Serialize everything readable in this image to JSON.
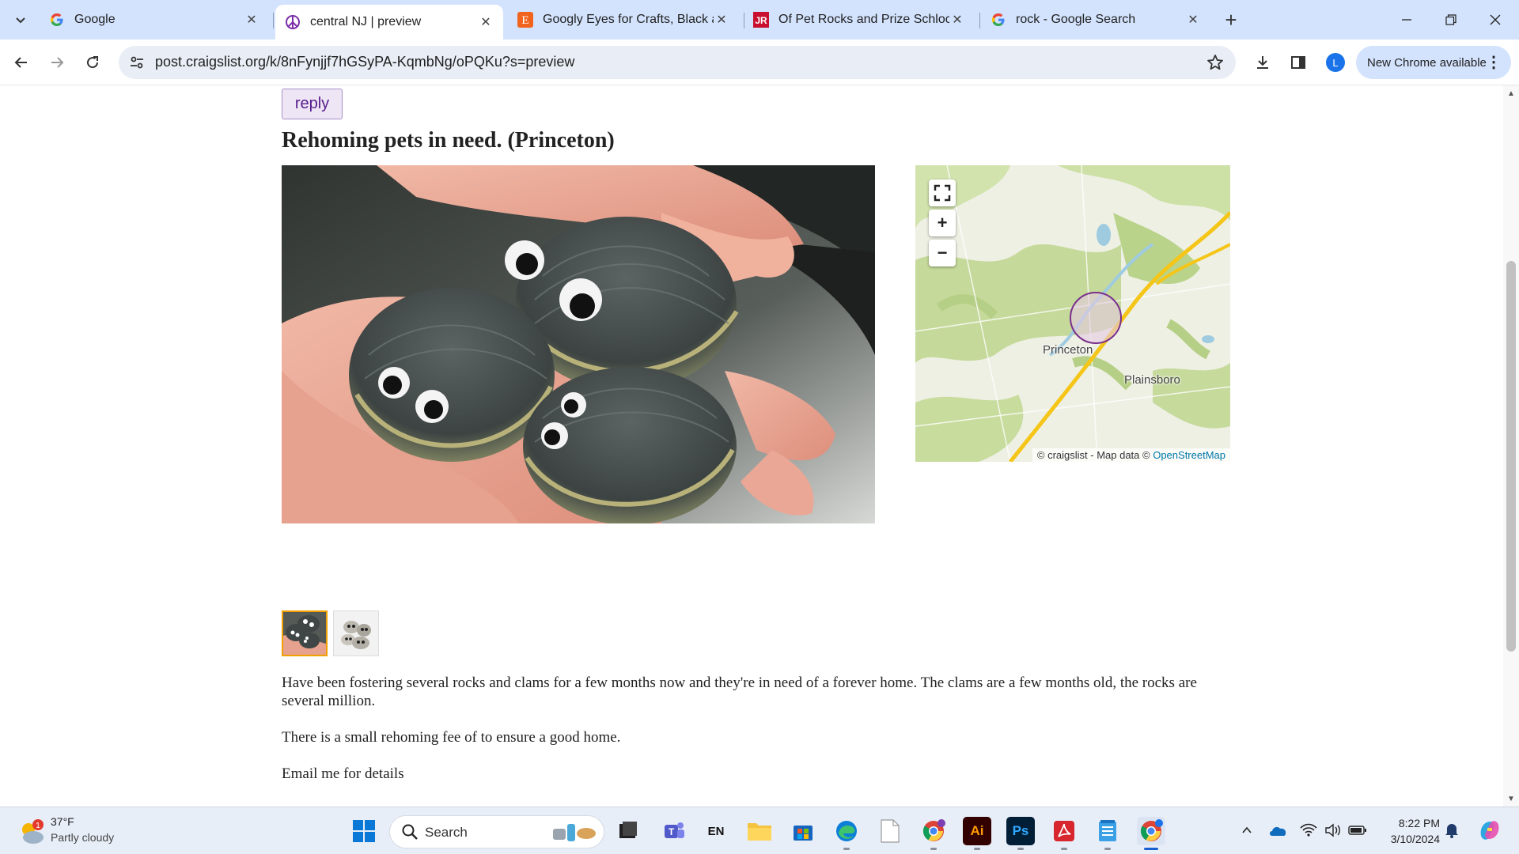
{
  "browser": {
    "tabs": [
      {
        "title": "Google",
        "favicon": "google-g-icon"
      },
      {
        "title": "central NJ | preview",
        "favicon": "peace-sign-icon",
        "active": true
      },
      {
        "title": "Googly Eyes for Crafts, Black an",
        "favicon": "etsy-e-icon"
      },
      {
        "title": "Of Pet Rocks and Prize Schlock",
        "favicon": "jr-logo-icon"
      },
      {
        "title": "rock - Google Search",
        "favicon": "google-g-icon"
      }
    ],
    "url": "post.craigslist.org/k/8nFynjjf7hGSyPA-KqmbNg/oPQKu?s=preview",
    "profile_initial": "L",
    "update_label": "New Chrome available"
  },
  "post": {
    "reply_label": "reply",
    "title": "Rehoming pets in need. (Princeton)",
    "body": [
      "Have been fostering several rocks and clams for a few months now and they're in need of a forever home. The clams are a few months old, the rocks are several million.",
      "There is a small rehoming fee of to ensure a good home.",
      "Email me for details"
    ]
  },
  "map": {
    "labels": {
      "princeton": "Princeton",
      "plainsboro": "Plainsboro"
    },
    "attribution_prefix": "© craigslist - Map data ©",
    "attribution_link": "OpenStreetMap",
    "zoom_in": "+",
    "zoom_out": "−"
  },
  "taskbar": {
    "weather": {
      "temp": "37°F",
      "condition": "Partly cloudy",
      "badge": "1"
    },
    "search_label": "Search",
    "language": "EN",
    "time": "8:22 PM",
    "date": "3/10/2024",
    "apps": [
      "windows-start-icon",
      "file-explorer-icon",
      "teams-icon",
      "language-icon",
      "folder-icon",
      "store-icon",
      "edge-icon",
      "file-icon",
      "chrome-icon",
      "illustrator-icon",
      "photoshop-icon",
      "acrobat-icon",
      "notepad-icon",
      "chrome-profile-icon"
    ],
    "illustrator_label": "Ai",
    "photoshop_label": "Ps"
  },
  "colors": {
    "tabstrip": "#d3e3fd",
    "reply_bg": "#eee6f5",
    "reply_text": "#551a8b",
    "link": "#0078a8",
    "thumb_selected": "#f0a000"
  }
}
